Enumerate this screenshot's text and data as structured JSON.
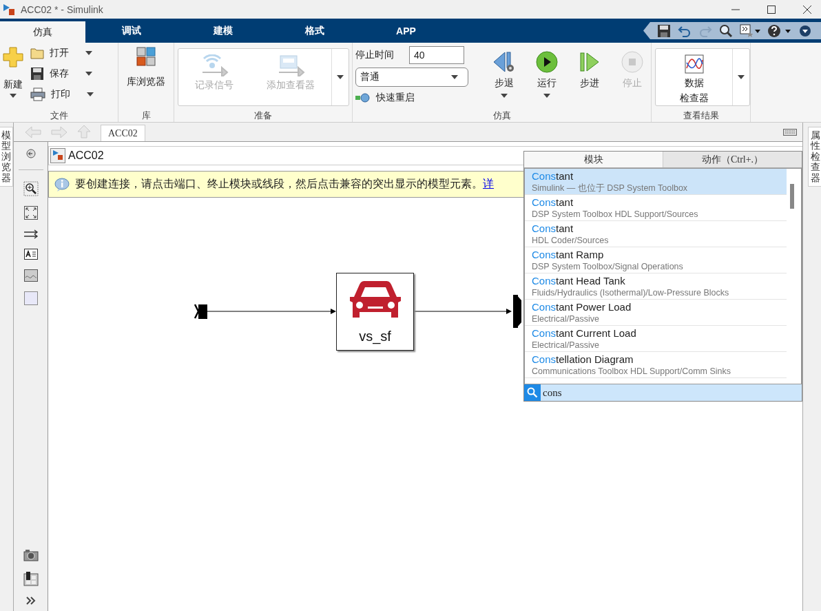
{
  "window": {
    "title": "ACC02 * - Simulink"
  },
  "tabs": [
    {
      "label": "仿真",
      "selected": true
    },
    {
      "label": "调试",
      "selected": false
    },
    {
      "label": "建模",
      "selected": false
    },
    {
      "label": "格式",
      "selected": false
    },
    {
      "label": "APP",
      "selected": false
    }
  ],
  "ribbon": {
    "groups": [
      {
        "kind": "file",
        "title": "文件",
        "new_label": "新建",
        "items": [
          {
            "kind": "open",
            "label": "打开"
          },
          {
            "kind": "save",
            "label": "保存"
          },
          {
            "kind": "print",
            "label": "打印"
          }
        ]
      },
      {
        "kind": "library",
        "title": "库",
        "label": "库浏览器"
      },
      {
        "kind": "prepare",
        "title": "准备",
        "buttons": [
          {
            "kind": "log",
            "label": "记录信号",
            "disabled": true
          },
          {
            "kind": "viewer",
            "label": "添加查看器",
            "disabled": true
          }
        ]
      },
      {
        "kind": "simulate",
        "title": "仿真",
        "stop_time_label": "停止时间",
        "stop_time": "40",
        "mode": "普通",
        "fast_restart": "快速重启",
        "buttons": [
          {
            "kind": "back",
            "label": "步退",
            "disabled": false,
            "dropdown": true
          },
          {
            "kind": "run",
            "label": "运行",
            "disabled": false,
            "dropdown": true
          },
          {
            "kind": "forward",
            "label": "步进",
            "disabled": false,
            "dropdown": false
          },
          {
            "kind": "stop",
            "label": "停止",
            "disabled": true,
            "dropdown": false
          }
        ]
      },
      {
        "kind": "results",
        "title": "查看结果",
        "label_lines": [
          "数据",
          "检查器"
        ]
      }
    ]
  },
  "editor": {
    "left_panel": "模型浏览器",
    "right_panel": "属性检查器",
    "tab": "ACC02",
    "breadcrumb": "ACC02",
    "info": {
      "text": "要创建连接，请点击端口、终止模块或线段，然后点击兼容的突出显示的模型元素。",
      "link": "详"
    },
    "block": {
      "name": "vs_sf"
    }
  },
  "quick_insert": {
    "tabs": [
      {
        "label": "模块",
        "selected": true
      },
      {
        "label": "动作（Ctrl+.）",
        "selected": false
      }
    ],
    "results": [
      {
        "match": "Cons",
        "rest": "tant",
        "library": "Simulink — 也位于 DSP System Toolbox",
        "selected": true
      },
      {
        "match": "Cons",
        "rest": "tant",
        "library": "DSP System Toolbox HDL Support/Sources",
        "selected": false
      },
      {
        "match": "Cons",
        "rest": "tant",
        "library": "HDL Coder/Sources",
        "selected": false
      },
      {
        "match": "Cons",
        "rest": "tant Ramp",
        "library": "DSP System Toolbox/Signal Operations",
        "selected": false
      },
      {
        "match": "Cons",
        "rest": "tant Head Tank",
        "library": "Fluids/Hydraulics (Isothermal)/Low-Pressure Blocks",
        "selected": false
      },
      {
        "match": "Cons",
        "rest": "tant Power Load",
        "library": "Electrical/Passive",
        "selected": false
      },
      {
        "match": "Cons",
        "rest": "tant Current Load",
        "library": "Electrical/Passive",
        "selected": false
      },
      {
        "match": "Cons",
        "rest": "tellation Diagram",
        "library": "Communications Toolbox HDL Support/Comm Sinks",
        "selected": false
      }
    ],
    "search": "cons"
  }
}
